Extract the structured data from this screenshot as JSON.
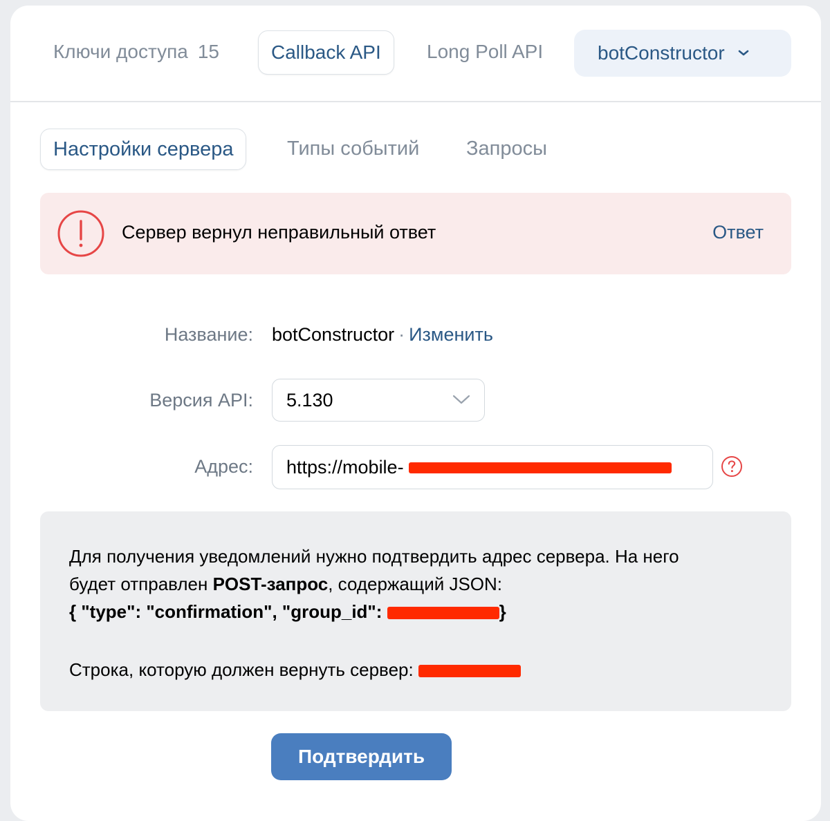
{
  "top_tabs": {
    "keys_label": "Ключи доступа",
    "keys_count": "15",
    "callback_label": "Callback API",
    "longpoll_label": "Long Poll API",
    "group_label": "botConstructor"
  },
  "sub_tabs": {
    "server_settings": "Настройки сервера",
    "event_types": "Типы событий",
    "requests": "Запросы"
  },
  "error": {
    "message": "Сервер вернул неправильный ответ",
    "link": "Ответ"
  },
  "form": {
    "name_label": "Название:",
    "name_value": "botConstructor",
    "name_separator": "·",
    "name_change": "Изменить",
    "version_label": "Версия API:",
    "version_value": "5.130",
    "address_label": "Адрес:",
    "address_value": "https://mobile-"
  },
  "info": {
    "line1": "Для получения уведомлений нужно подтвердить адрес сервера. На него",
    "line2_prefix": "будет отправлен",
    "line2_bold": "POST-запрос",
    "line2_suffix": ", содержащий JSON:",
    "line3_json": "{ \"type\": \"confirmation\", \"group_id\": ",
    "line3_close": "}",
    "line4": "Строка, которую должен вернуть сервер:"
  },
  "confirm_button": "Подтвердить",
  "colors": {
    "accent": "#2a5885",
    "button": "#4a7ebf",
    "error_bg": "#faebeb",
    "error_icon": "#e64646",
    "redaction": "#ff2a00"
  }
}
